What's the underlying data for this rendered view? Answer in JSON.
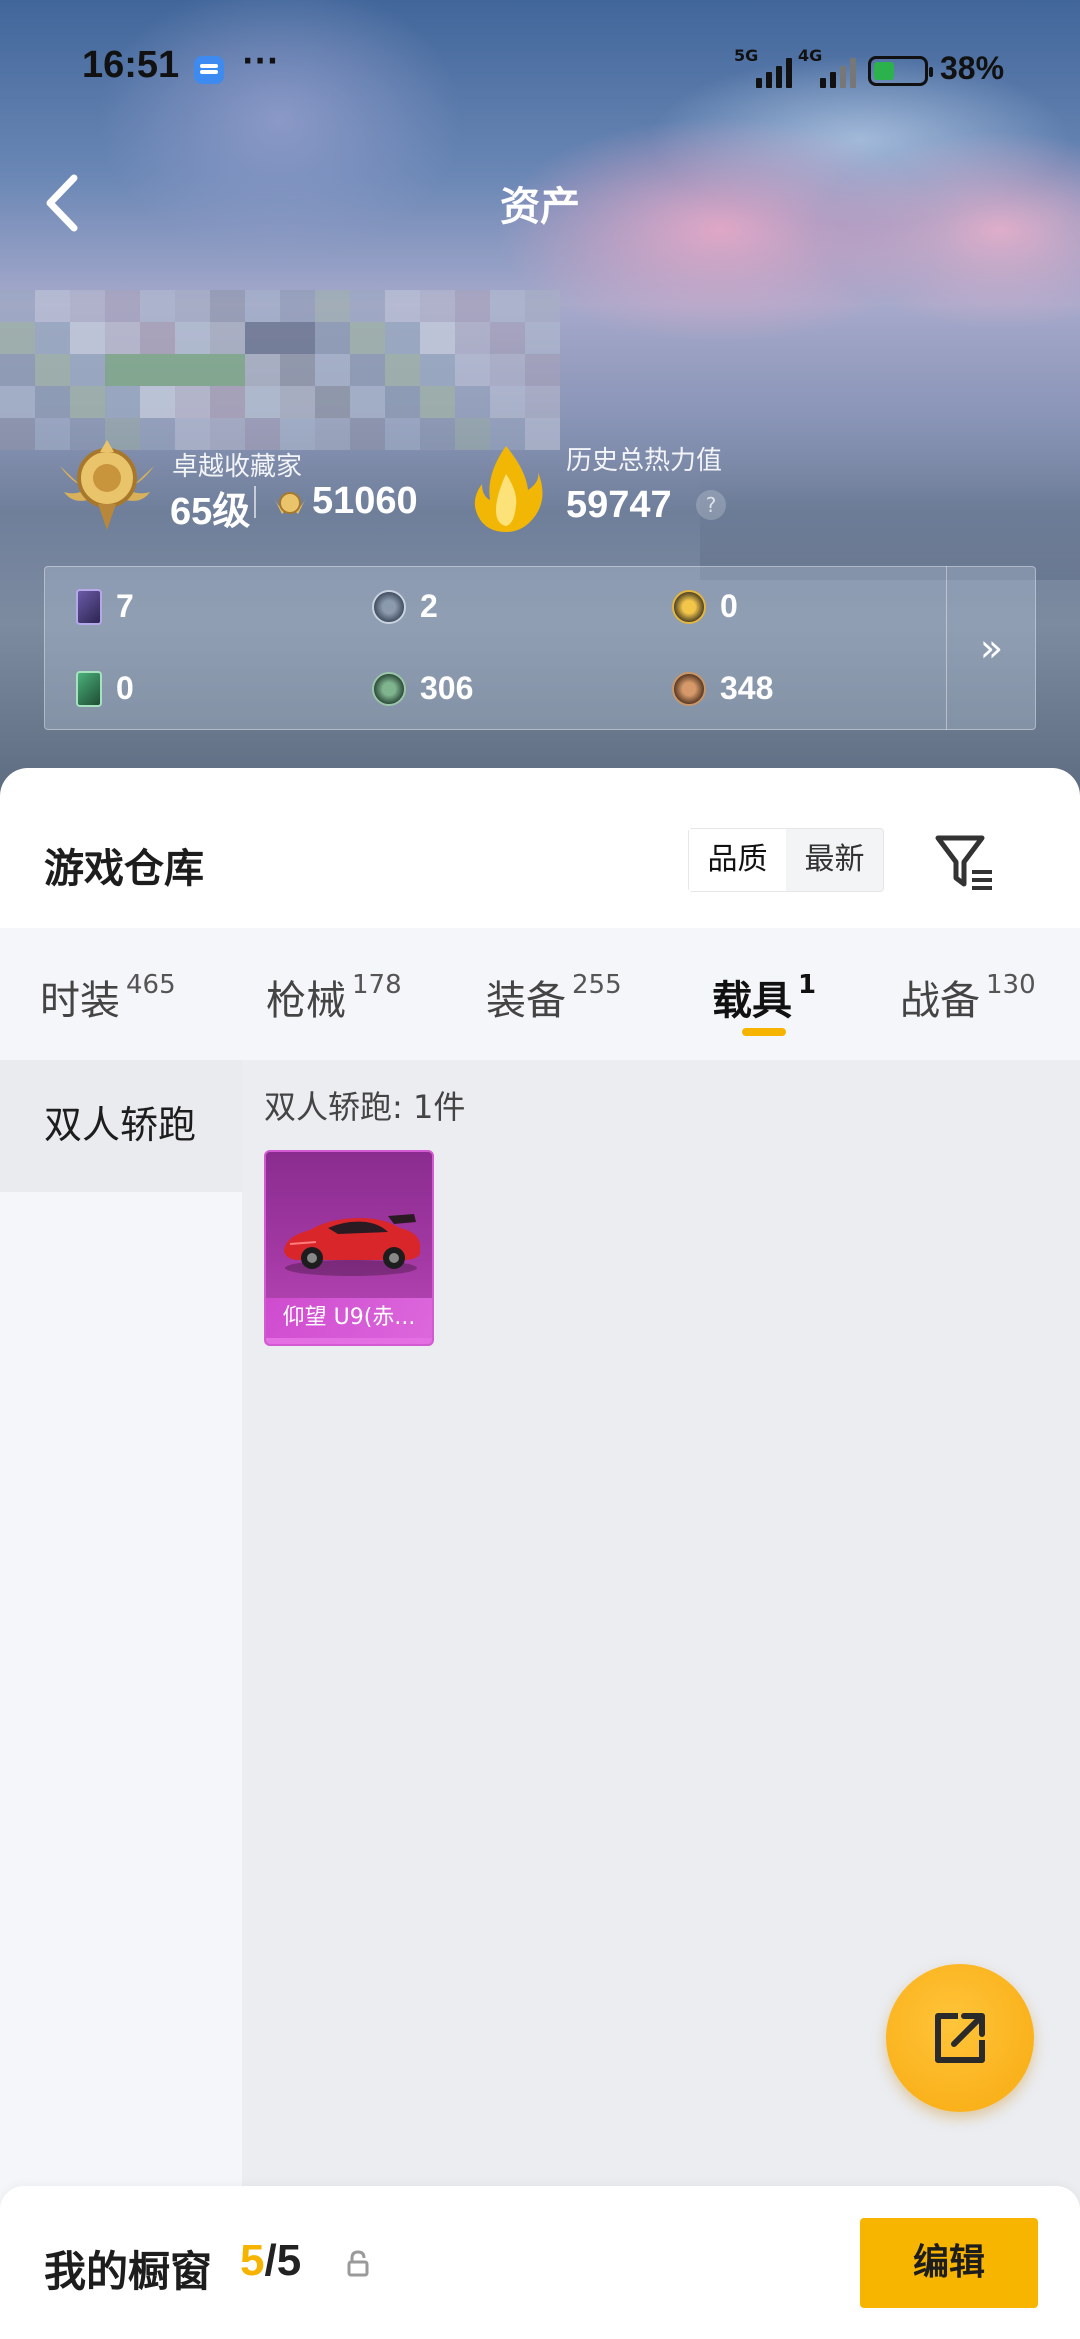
{
  "status_bar": {
    "time": "16:51",
    "more": "···",
    "net1": "5G",
    "net2": "4G",
    "battery": "38%"
  },
  "header": {
    "title": "资产"
  },
  "collector": {
    "title": "卓越收藏家",
    "level": "65级",
    "points": "51060"
  },
  "heat": {
    "label": "历史总热力值",
    "value": "59747",
    "help": "?"
  },
  "resources": [
    {
      "icon": "purple-card-icon",
      "value": "7"
    },
    {
      "icon": "silver-coin-icon",
      "value": "2"
    },
    {
      "icon": "gold-coin-icon",
      "value": "0"
    },
    {
      "icon": "green-card-icon",
      "value": "0"
    },
    {
      "icon": "green-coin-icon",
      "value": "306"
    },
    {
      "icon": "bronze-coin-icon",
      "value": "348"
    }
  ],
  "resources_more": "»",
  "warehouse": {
    "title": "游戏仓库",
    "sort_options": [
      "品质",
      "最新"
    ],
    "sort_selected": "品质"
  },
  "tabs": [
    {
      "label": "时装",
      "count": "465"
    },
    {
      "label": "枪械",
      "count": "178"
    },
    {
      "label": "装备",
      "count": "255"
    },
    {
      "label": "载具",
      "count": "1",
      "active": true
    },
    {
      "label": "战备",
      "count": "130"
    }
  ],
  "sidebar": {
    "items": [
      {
        "label": "双人轿跑",
        "active": true
      }
    ]
  },
  "content": {
    "subtitle": "双人轿跑: 1件",
    "items": [
      {
        "name": "仰望 U9(赤..."
      }
    ]
  },
  "bottom": {
    "label": "我的橱窗",
    "current": "5",
    "separator": "/",
    "total": "5",
    "edit": "编辑"
  },
  "colors": {
    "accent": "#f6b400",
    "item_rarity": "#a63aa6"
  }
}
